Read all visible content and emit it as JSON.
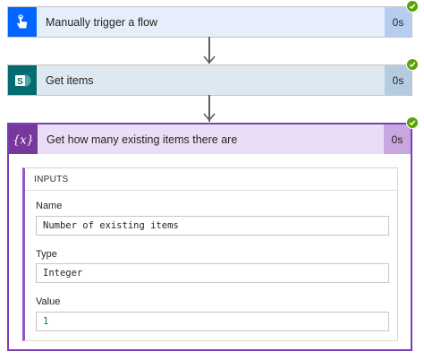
{
  "steps": [
    {
      "title": "Manually trigger a flow",
      "duration": "0s",
      "status": "succeeded",
      "icon": "touch-icon",
      "icon_bg": "#0066ff",
      "header_bg": "#e6eefb",
      "duration_bg": "#b6cdf0"
    },
    {
      "title": "Get items",
      "duration": "0s",
      "status": "succeeded",
      "icon": "sharepoint-icon",
      "icon_bg": "#036c70",
      "header_bg": "#dde8f0",
      "duration_bg": "#b5cbe0"
    },
    {
      "title": "Get how many existing items there are",
      "duration": "0s",
      "status": "succeeded",
      "icon": "variable-icon",
      "icon_bg": "#77389b",
      "header_bg": "#ebddf6",
      "duration_bg": "#c8a6e0"
    }
  ],
  "inputs": {
    "title": "INPUTS",
    "fields": [
      {
        "label": "Name",
        "value": "Number of existing items"
      },
      {
        "label": "Type",
        "value": "Integer"
      },
      {
        "label": "Value",
        "value": "1"
      }
    ]
  },
  "colors": {
    "success": "#57a300",
    "accent": "#7a3fb8",
    "connector": "#605e5c"
  }
}
